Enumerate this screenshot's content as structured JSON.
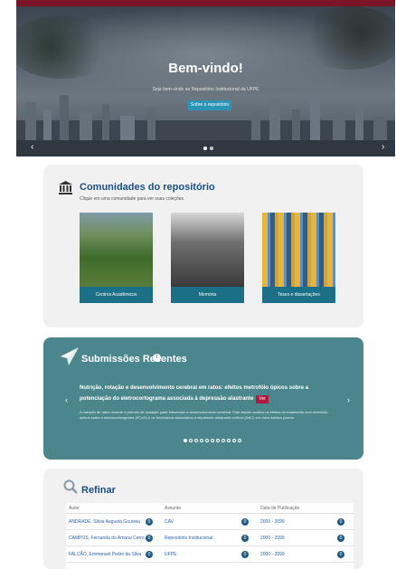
{
  "hero": {
    "title": "Bem-vindo!",
    "subtitle": "Seja bem-vindo ao Repositório Institucional da UFPE",
    "button_label": "Sobre o repositório",
    "prev_arrow": "‹",
    "next_arrow": "›"
  },
  "communities": {
    "title": "Comunidades do repositório",
    "subtitle": "Clique em uma comunidade para ver suas coleções",
    "cards": [
      {
        "label": "Centros Acadêmicos"
      },
      {
        "label": "Memória"
      },
      {
        "label": "Teses e dissertações"
      }
    ]
  },
  "recent": {
    "title": "Submissões Recentes",
    "badge": "i",
    "headline": "Nutrição, rotação e desenvolvimento cerebral em ratos: efeitos metrofólo ópicos sobre a potenciação do eletrocortograma associada à depressão alastrante",
    "tag": "Ver",
    "body": "A nutrição de ratos durante o período de lactação pode influenciar o desenvolvimento cerebral. Este estudo avaliou os efeitos do tratamento com metrofólo ópicos sobre o eletrocorticograma (ECoG) e os fenômenos associados a depressão alastrante cortical (DAC) em ratos adultos jovens.",
    "prev_arrow": "‹",
    "next_arrow": "›",
    "dots": 11,
    "active_dot": 0
  },
  "refine": {
    "title": "Refinar",
    "columns": [
      {
        "header": "Autor",
        "rows": [
          {
            "label": "ANDRADE, Sílvia Augusta Gouveia",
            "count": "0"
          },
          {
            "label": "CAMPOS, Fernanda do Amaral Cerro...",
            "count": "0"
          },
          {
            "label": "FALCÃO, Emmanuel Pedro da Silva",
            "count": "0"
          }
        ]
      },
      {
        "header": "Assunto",
        "rows": [
          {
            "label": "CAV",
            "count": "0"
          },
          {
            "label": "Repositório Institucional",
            "count": "0"
          },
          {
            "label": "UFPE",
            "count": "0"
          }
        ]
      },
      {
        "header": "Data de Publicação",
        "rows": [
          {
            "label": "2000 - 2099",
            "count": "0"
          },
          {
            "label": "2000 - 2099",
            "count": "0"
          },
          {
            "label": "2000 - 2099",
            "count": "0"
          }
        ]
      }
    ]
  }
}
